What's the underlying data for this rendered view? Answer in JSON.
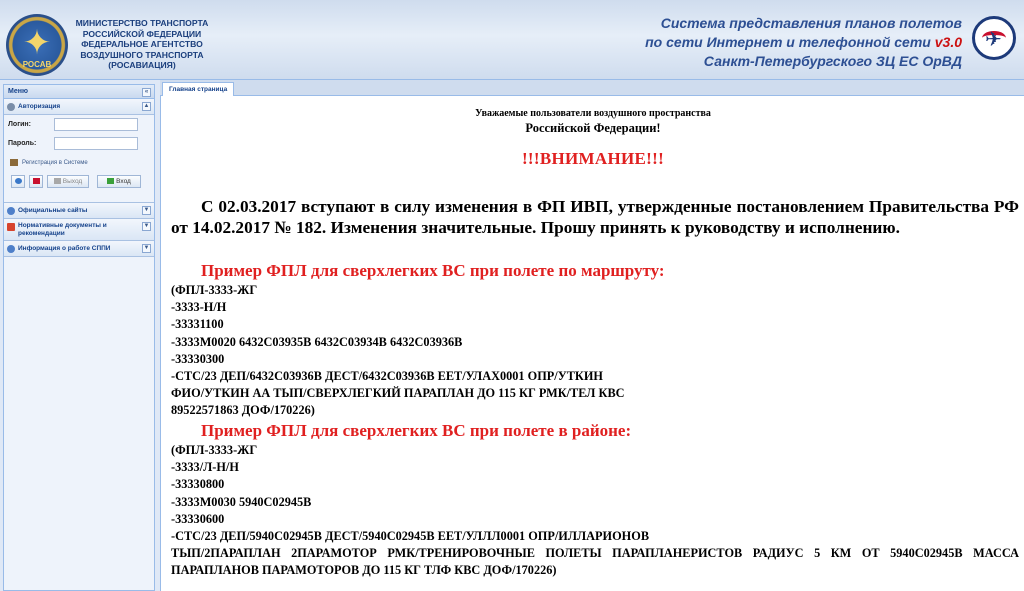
{
  "header": {
    "emblem_text": "РОСАВ",
    "ministry_lines": [
      "МИНИСТЕРСТВО ТРАНСПОРТА",
      "РОССИЙСКОЙ ФЕДЕРАЦИИ",
      "ФЕДЕРАЛЬНОЕ АГЕНТСТВО",
      "ВОЗДУШНОГО ТРАНСПОРТА",
      "(РОСАВИАЦИЯ)"
    ],
    "system_title_line1": "Система представления планов полетов",
    "system_title_line2": "по сети Интернет и телефонной сети",
    "version": "v3.0",
    "system_title_line3": "Санкт-Петербургского ЗЦ ЕС ОрВД"
  },
  "sidebar": {
    "menu_title": "Меню",
    "auth_title": "Авторизация",
    "login_label": "Логин:",
    "password_label": "Пароль:",
    "register_link": "Регистрация в Системе",
    "logout_button": "Выход",
    "login_button": "Вход",
    "sections": [
      "Официальные сайты",
      "Нормативные документы и рекомендации",
      "Информация о работе СППИ"
    ]
  },
  "tabs": {
    "home": "Главная страница"
  },
  "content": {
    "greeting_line1": "Уважаемые пользователи воздушного пространства",
    "greeting_line2": "Российской Федерации!",
    "attention": "!!!ВНИМАНИЕ!!!",
    "notice": "С 02.03.2017 вступают в силу изменения в ФП ИВП, утвержденные постановлением Правительства РФ от 14.02.2017 № 182. Изменения значительные. Прошу принять к руководству и исполнению.",
    "example1_title": "Пример ФПЛ для сверхлегких ВС при полете по маршруту:",
    "example1_lines": [
      "(ФПЛ-3333-ЖГ",
      "-3333-Н/Н",
      "-33331100",
      "-3333М0020 6432С03935В 6432С03934В 6432С03936В",
      "-33330300",
      "-СТС/23 ДЕП/6432С03936В ДЕСТ/6432С03936В ЕЕТ/УЛАХ0001 ОПР/УТКИН",
      "ФИО/УТКИН АА ТЫП/СВЕРХЛЕГКИЙ ПАРАПЛАН ДО 115 КГ РМК/ТЕЛ КВС",
      "89522571863 ДОФ/170226)"
    ],
    "example2_title": "Пример ФПЛ для сверхлегких ВС при полете в районе:",
    "example2_lines": [
      "(ФПЛ-3333-ЖГ",
      "-3333/Л-Н/Н",
      "-33330800",
      "-3333М0030 5940С02945В",
      "-33330600",
      "-СТС/23 ДЕП/5940С02945В ДЕСТ/5940С02945В ЕЕТ/УЛЛЛ0001 ОПР/ИЛЛАРИОНОВ"
    ],
    "example2_last": "ТЫП/2ПАРАПЛАН 2ПАРАМОТОР РМК/ТРЕНИРОВОЧНЫЕ ПОЛЕТЫ ПАРАПЛАНЕРИСТОВ РАДИУС 5 КМ ОТ 5940С02945В МАССА ПАРАПЛАНОВ ПАРАМОТОРОВ ДО 115 КГ ТЛФ КВС ДОФ/170226)"
  }
}
